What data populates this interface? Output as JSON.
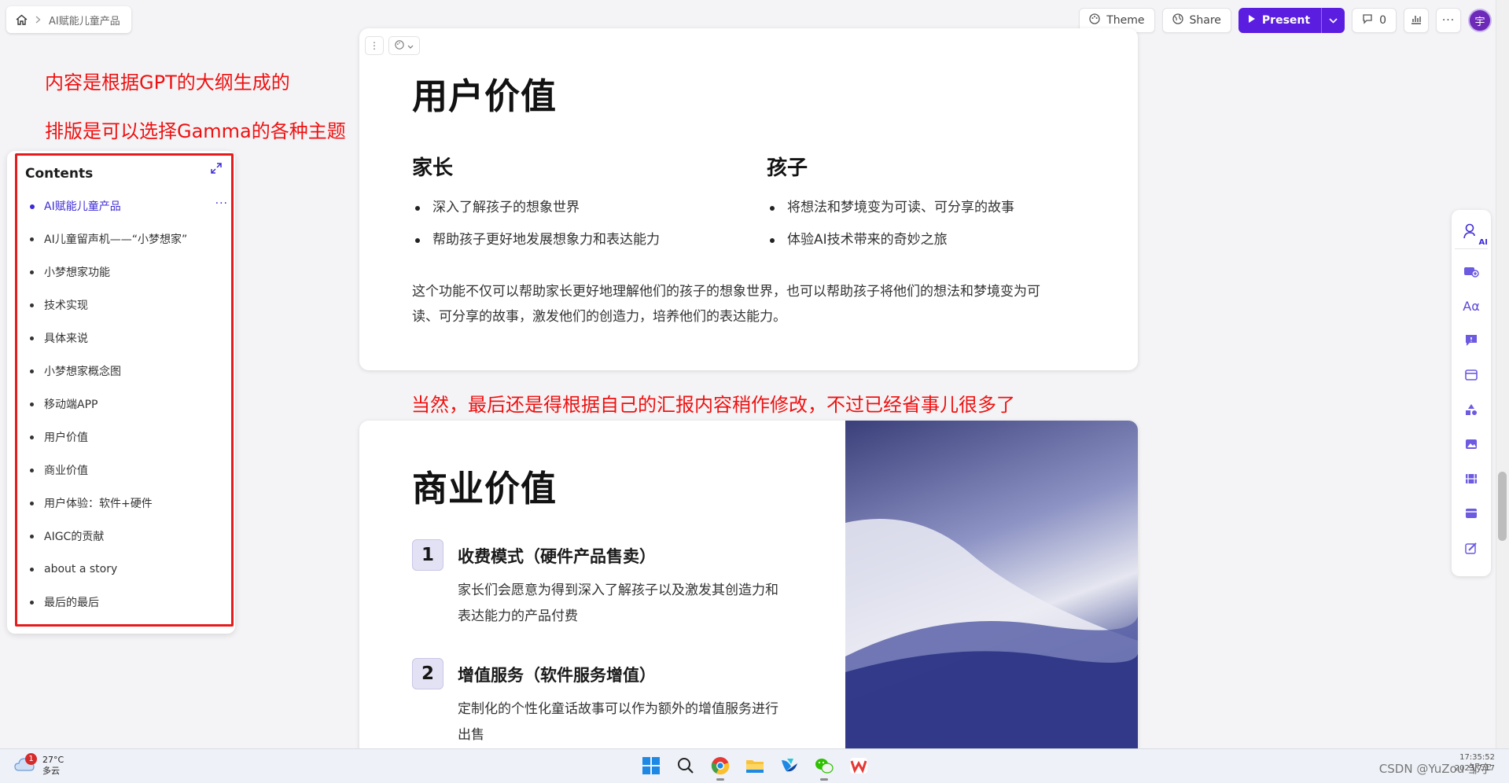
{
  "breadcrumb": {
    "home_icon": "home-icon",
    "doc_title": "AI赋能儿童产品"
  },
  "toolbar": {
    "theme_label": "Theme",
    "share_label": "Share",
    "present_label": "Present",
    "comments_count": "0",
    "avatar_initial": "宇"
  },
  "annotations": {
    "top_line1": "内容是根据GPT的大纲生成的",
    "top_line2": "排版是可以选择Gamma的各种主题",
    "middle": "当然，最后还是得根据自己的汇报内容稍作修改，不过已经省事儿很多了"
  },
  "contents": {
    "title": "Contents",
    "items": [
      {
        "label": "AI赋能儿童产品",
        "active": true
      },
      {
        "label": "AI儿童留声机——“小梦想家”"
      },
      {
        "label": "小梦想家功能"
      },
      {
        "label": "技术实现"
      },
      {
        "label": "具体来说"
      },
      {
        "label": "小梦想家概念图"
      },
      {
        "label": "移动端APP"
      },
      {
        "label": "用户价值"
      },
      {
        "label": "商业价值"
      },
      {
        "label": "用户体验：软件+硬件"
      },
      {
        "label": "AIGC的贡献"
      },
      {
        "label": "about a story"
      },
      {
        "label": "最后的最后"
      }
    ],
    "more": "···"
  },
  "card1": {
    "title": "用户价值",
    "col1_title": "家长",
    "col1_items": [
      "深入了解孩子的想象世界",
      "帮助孩子更好地发展想象力和表达能力"
    ],
    "col2_title": "孩子",
    "col2_items": [
      "将想法和梦境变为可读、可分享的故事",
      "体验AI技术带来的奇妙之旅"
    ],
    "paragraph_line1": "这个功能不仅可以帮助家长更好地理解他们的孩子的想象世界，也可以帮助孩子将他们的想法和梦境变为可",
    "paragraph_line2": "读、可分享的故事，激发他们的创造力，培养他们的表达能力。"
  },
  "card2": {
    "title": "商业价值",
    "items": [
      {
        "num": "1",
        "title": "收费模式（硬件产品售卖）",
        "desc_line1": "家长们会愿意为得到深入了解孩子以及激发其创造力和",
        "desc_line2": "表达能力的产品付费"
      },
      {
        "num": "2",
        "title": "增值服务（软件服务增值）",
        "desc_line1": "定制化的个性化童话故事可以作为额外的增值服务进行",
        "desc_line2": "出售"
      }
    ]
  },
  "right_sidebar": {
    "ai_label": "AI",
    "aa_label": "Aα"
  },
  "taskbar": {
    "weather_badge": "1",
    "temperature": "27°C",
    "condition": "多云",
    "watermark": "CSDN @YuZou 邹宇",
    "time": "17:35:52",
    "date": "2023/7/17"
  },
  "colors": {
    "accent": "#5b1ee0",
    "annotation": "#ee1111",
    "active_link": "#3d2bd6"
  }
}
